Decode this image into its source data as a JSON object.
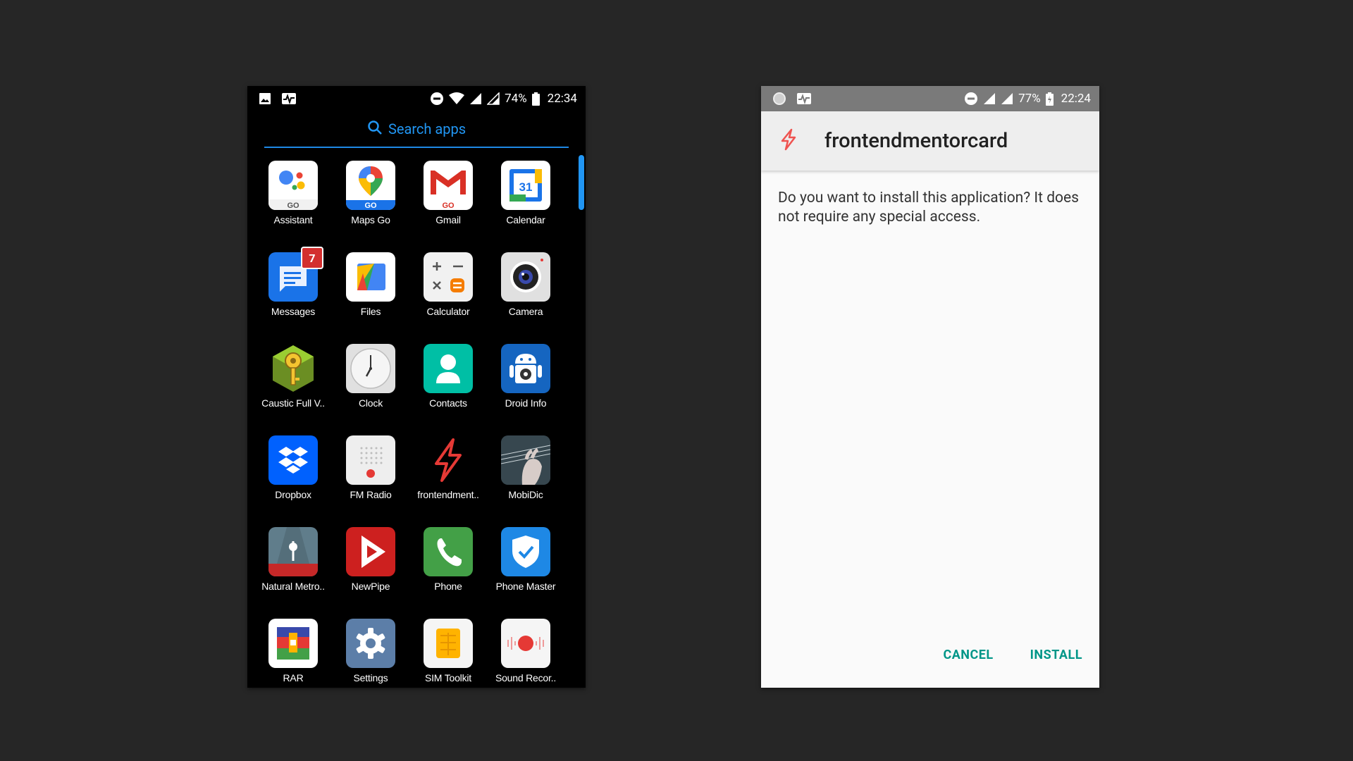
{
  "left_screen": {
    "status": {
      "battery": "74%",
      "time": "22:34"
    },
    "search_placeholder": "Search apps",
    "apps": [
      {
        "label": "Assistant",
        "icon": "google-assistant-go-icon"
      },
      {
        "label": "Maps Go",
        "icon": "maps-go-icon"
      },
      {
        "label": "Gmail",
        "icon": "gmail-go-icon"
      },
      {
        "label": "Calendar",
        "icon": "calendar-icon",
        "day": "31"
      },
      {
        "label": "Messages",
        "icon": "messages-icon",
        "badge": "7"
      },
      {
        "label": "Files",
        "icon": "files-icon"
      },
      {
        "label": "Calculator",
        "icon": "calculator-icon"
      },
      {
        "label": "Camera",
        "icon": "camera-icon"
      },
      {
        "label": "Caustic Full V..",
        "icon": "caustic-key-icon"
      },
      {
        "label": "Clock",
        "icon": "clock-icon"
      },
      {
        "label": "Contacts",
        "icon": "contacts-icon"
      },
      {
        "label": "Droid Info",
        "icon": "android-robot-icon"
      },
      {
        "label": "Dropbox",
        "icon": "dropbox-icon"
      },
      {
        "label": "FM Radio",
        "icon": "fm-radio-icon"
      },
      {
        "label": "frontendment..",
        "icon": "lightning-bolt-icon"
      },
      {
        "label": "MobiDic",
        "icon": "guitar-photo-icon"
      },
      {
        "label": "Natural Metro..",
        "icon": "metronome-icon"
      },
      {
        "label": "NewPipe",
        "icon": "newpipe-play-icon"
      },
      {
        "label": "Phone",
        "icon": "phone-icon"
      },
      {
        "label": "Phone Master",
        "icon": "shield-check-icon"
      },
      {
        "label": "RAR",
        "icon": "rar-archive-icon"
      },
      {
        "label": "Settings",
        "icon": "gear-icon"
      },
      {
        "label": "SIM Toolkit",
        "icon": "sim-card-icon"
      },
      {
        "label": "Sound Recor..",
        "icon": "sound-recorder-icon"
      }
    ]
  },
  "right_screen": {
    "status": {
      "battery": "77%",
      "time": "22:24"
    },
    "app_name": "frontendmentorcard",
    "message": "Do you want to install this application? It does not require any special access.",
    "cancel_label": "CANCEL",
    "install_label": "INSTALL"
  },
  "colors": {
    "accent_blue": "#2196f3",
    "teal_button": "#009688",
    "background": "#262626"
  }
}
